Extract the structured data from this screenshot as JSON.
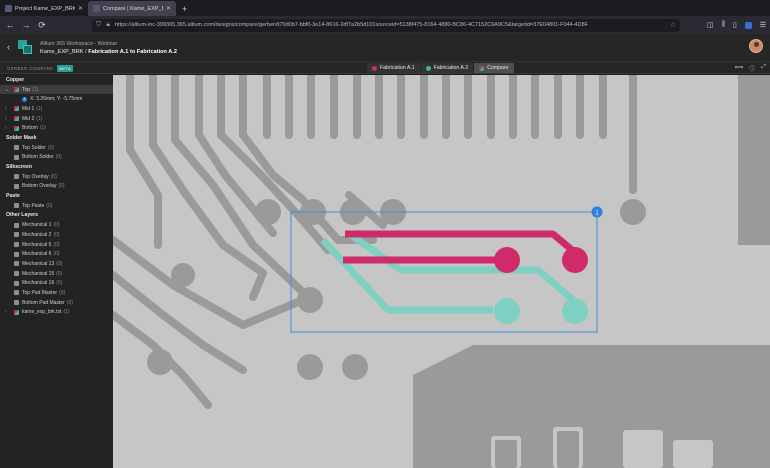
{
  "browser": {
    "tabs": [
      {
        "label": "Project Kame_EXP_BRK | Altium",
        "active": false
      },
      {
        "label": "Compare | Kame_EXP_BRK | Al",
        "active": true
      }
    ],
    "new_tab_glyph": "+",
    "url": "https://altium-inc-399365.365.altium.com/designs/compare/gerber/d70d0b7-bbf0-3e14-8616-2df7a2b5d101sourceid=5138f475-8164-4880-BC86-4C7152C6A9C5&targetid=37E04801-F044-4D8F",
    "nav": {
      "back": "←",
      "forward": "→",
      "reload": "⟳"
    },
    "icons": [
      "shield-icon",
      "lock-icon",
      "star-icon",
      "pocket-icon",
      "library-icon",
      "sidebar-icon",
      "extension-icon",
      "menu-icon"
    ]
  },
  "app": {
    "back_glyph": "‹",
    "workspace": "Altium 365 Workspace - Webinar",
    "project": "Kame_EXP_BRK",
    "separator": "/",
    "compare_title": "Fabrication A.1 to Fabrication A.2",
    "brand_colors": {
      "teal": "#2aa198",
      "accent_a1": "#cf2b6b",
      "accent_a2": "#3fb6a3"
    }
  },
  "toolbar": {
    "section_label": "GERBER COMPARE",
    "beta_label": "BETA",
    "pills": [
      {
        "label": "Fabrication A.1",
        "color": "#cf2b6b",
        "selected": false
      },
      {
        "label": "Fabrication A.2",
        "color": "#3fb6a3",
        "selected": false
      },
      {
        "label": "Compare",
        "color": "dual",
        "selected": true
      }
    ],
    "view_icons": [
      "ruler-icon",
      "info-icon",
      "fullscreen-icon"
    ]
  },
  "sidebar": {
    "groups": [
      {
        "label": "Copper",
        "layers": [
          {
            "label": "Top",
            "count": "(1)",
            "expanded": true,
            "highlight": true,
            "swatch": "dual",
            "detail": "X: 3.26mm; Y: -5.75mm"
          },
          {
            "label": "Mid 1",
            "count": "(1)",
            "expandable": true,
            "swatch": "dual"
          },
          {
            "label": "Mid 2",
            "count": "(1)",
            "expandable": true,
            "swatch": "dual"
          },
          {
            "label": "Bottom",
            "count": "(1)",
            "expandable": true,
            "swatch": "dual"
          }
        ]
      },
      {
        "label": "Solder Mask",
        "layers": [
          {
            "label": "Top Solder",
            "count": "(0)"
          },
          {
            "label": "Bottom Solder",
            "count": "(0)"
          }
        ]
      },
      {
        "label": "Silkscreen",
        "layers": [
          {
            "label": "Top Overlay",
            "count": "(0)"
          },
          {
            "label": "Bottom Overlay",
            "count": "(0)"
          }
        ]
      },
      {
        "label": "Paste",
        "layers": [
          {
            "label": "Top Paste",
            "count": "(0)"
          }
        ]
      },
      {
        "label": "Other Layers",
        "layers": [
          {
            "label": "Mechanical 1",
            "count": "(0)"
          },
          {
            "label": "Mechanical 2",
            "count": "(0)"
          },
          {
            "label": "Mechanical 5",
            "count": "(0)"
          },
          {
            "label": "Mechanical 6",
            "count": "(0)"
          },
          {
            "label": "Mechanical 13",
            "count": "(0)"
          },
          {
            "label": "Mechanical 15",
            "count": "(0)"
          },
          {
            "label": "Mechanical 16",
            "count": "(0)"
          },
          {
            "label": "Top Pad Master",
            "count": "(0)"
          },
          {
            "label": "Bottom Pad Master",
            "count": "(0)"
          },
          {
            "label": "kame_exp_brk.txt",
            "count": "(1)",
            "expandable": true,
            "swatch": "dual"
          }
        ]
      }
    ]
  },
  "canvas": {
    "marker_label": "1",
    "colors": {
      "background": "#c6c6c6",
      "copper": "#9a9a9a",
      "a1": "#cf2b6b",
      "a2": "#7fcfc2",
      "selection": "#3d8fe0"
    }
  }
}
